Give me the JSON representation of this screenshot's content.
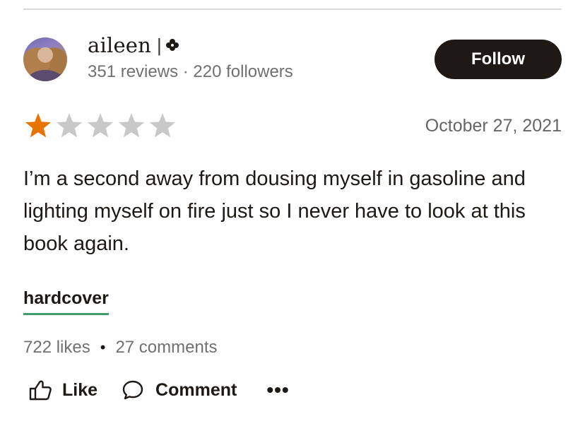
{
  "user": {
    "name": "aileen",
    "separator": "|",
    "badge_icon": "clover-icon",
    "stats": "351 reviews · 220 followers"
  },
  "follow": {
    "label": "Follow"
  },
  "rating": {
    "value": 1,
    "max": 5,
    "filled_color": "#e87400",
    "empty_color": "#c8c8c8"
  },
  "review": {
    "date": "October 27, 2021",
    "text": "I’m a second away from dousing myself in gasoline and lighting myself on fire just so I never have to look at this book again.",
    "shelf": "hardcover",
    "shelf_underline_color": "#409d69"
  },
  "engagement": {
    "likes": "722 likes",
    "separator": "•",
    "comments": "27 comments"
  },
  "actions": {
    "like_label": "Like",
    "comment_label": "Comment",
    "more_label": "•••",
    "like_icon": "thumbs-up-icon",
    "comment_icon": "comment-bubble-icon"
  }
}
